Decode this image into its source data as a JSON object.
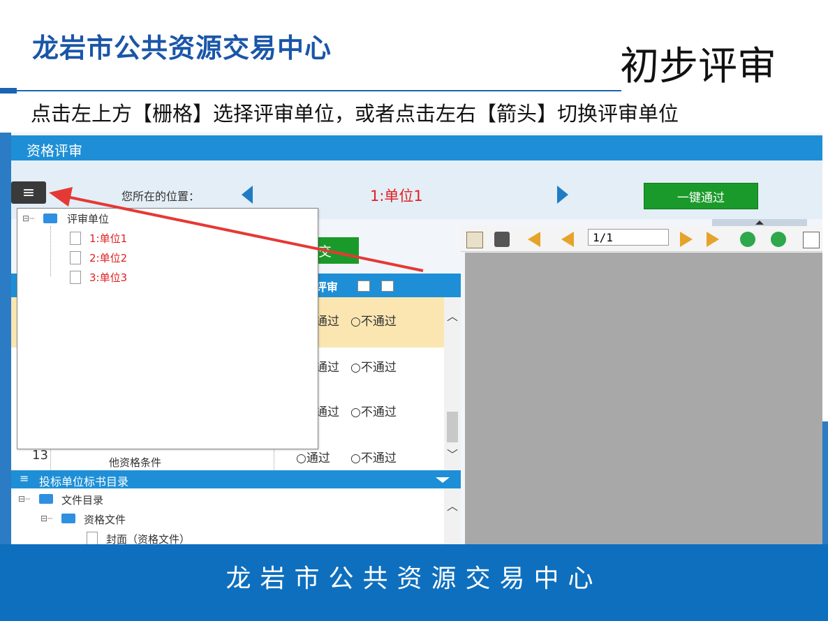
{
  "slide": {
    "org_title": "龙岩市公共资源交易中心",
    "title": "初步评审",
    "instruction": "点击左上方【栅格】选择评审单位，或者点击左右【箭头】切换评审单位",
    "footer": "龙岩市公共资源交易中心"
  },
  "app": {
    "header_title": "资格评审",
    "location_label": "您所在的位置：",
    "current_unit": "1:单位1",
    "pass_all_button": "一键通过",
    "submit_button": "交"
  },
  "unit_tree": {
    "root_label": "评审单位",
    "units": [
      "1:单位1",
      "2:单位2",
      "3:单位3"
    ]
  },
  "review_table": {
    "column_review": "评审",
    "rows": [
      {
        "pass": "通过",
        "fail": "○不通过"
      },
      {
        "pass": "通过",
        "fail": "○不通过"
      },
      {
        "pass": "通过",
        "fail": "○不通过"
      },
      {
        "num": "13",
        "desc": "他资格条件",
        "pass": "○通过",
        "fail": "○不通过"
      }
    ]
  },
  "catalog": {
    "title": "投标单位标书目录",
    "root_label": "文件目录",
    "folder_label": "资格文件",
    "doc_label": "封面（资格文件）"
  },
  "viewer": {
    "page_value": "1/1"
  },
  "colors": {
    "brand_blue": "#1a56a8",
    "header_blue": "#1e8fd6",
    "green": "#1a9a2a",
    "unit_red": "#e02020",
    "pointer_arrow": "#e53935"
  }
}
